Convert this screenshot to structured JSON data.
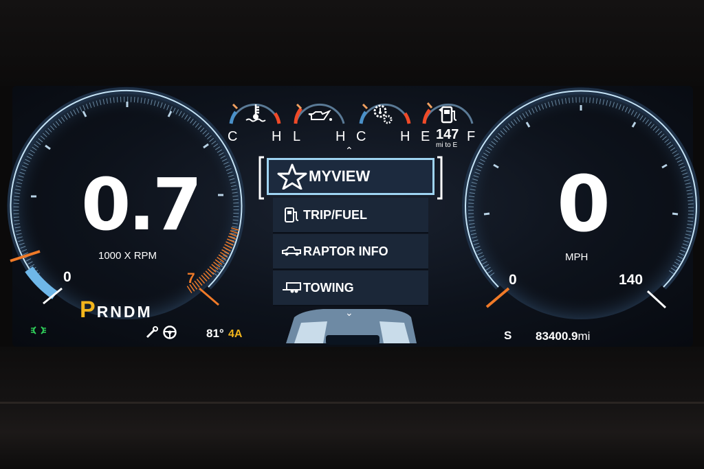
{
  "tachometer": {
    "value": "0.7",
    "unit": "1000 X RPM",
    "scale_min": "0",
    "scale_max": "7"
  },
  "speedometer": {
    "value": "0",
    "unit": "MPH",
    "scale_min": "0",
    "scale_max": "140"
  },
  "gauges": [
    {
      "icon": "coolant-temperature-icon",
      "low": "C",
      "high": "H"
    },
    {
      "icon": "oil-pressure-icon",
      "low": "L",
      "high": "H"
    },
    {
      "icon": "transmission-temperature-icon",
      "low": "C",
      "high": "H"
    },
    {
      "icon": "fuel-pump-icon",
      "low": "E",
      "high": "F",
      "range_value": "147",
      "range_unit": "mi to E"
    }
  ],
  "menu": {
    "selected": {
      "label": "MYVIEW",
      "icon": "star-icon"
    },
    "items": [
      {
        "label": "TRIP/FUEL",
        "icon": "fuel-pump-icon"
      },
      {
        "label": "RAPTOR INFO",
        "icon": "truck-icon"
      },
      {
        "label": "TOWING",
        "icon": "trailer-icon"
      }
    ]
  },
  "gear_selector": {
    "active": "P",
    "others": "RNDM"
  },
  "status_bar": {
    "outside_temp": "81°",
    "drive_mode": "4A",
    "compass": "S",
    "odometer": "83400.9",
    "odometer_unit": "mi"
  },
  "colors": {
    "accent_blue": "#4a90c8",
    "warning_orange": "#f07a28",
    "gear_active_yellow": "#f2b51c",
    "headlight_green": "#2fd05a"
  }
}
